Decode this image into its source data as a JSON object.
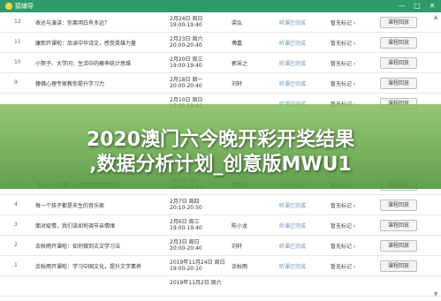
{
  "window": {
    "title": "猿辅导",
    "minimize": "—",
    "restore": "□",
    "close": "✕"
  },
  "rows": [
    {
      "index": "12",
      "title": "表达与演讲：你离明白有多远？",
      "date1": "2月24日 周日",
      "date2": "19:00-19:40",
      "teacher": "梁弘",
      "status": "听课已完成",
      "mark": "暂无标记 ›",
      "button": "课程回放"
    },
    {
      "index": "11",
      "title": "康熙开课啦：品读中华诗文，感受英雄力量",
      "date1": "2月23日 周六",
      "date2": "20:00-20:40",
      "teacher": "傅嘉",
      "status": "听课已完成",
      "mark": "暂无标记 ›",
      "button": "课程回放"
    },
    {
      "index": "10",
      "title": "小贺子、大学问：生活中的概率统计思维",
      "date1": "2月20日 周三",
      "date2": "19:00-19:40",
      "teacher": "郭采之",
      "status": "听课已完成",
      "mark": "暂无标记 ›",
      "button": "课程回放"
    },
    {
      "index": "9",
      "title": "猿佛心理专家教你提升学习力",
      "date1": "2月18日 周一",
      "date2": "20:00-20:40",
      "teacher": "刘轩",
      "status": "听课已完成",
      "mark": "暂无标记 ›",
      "button": "课程回放"
    },
    {
      "index": "",
      "title": "",
      "date1": "2月10日 周日",
      "date2": "19:00-19:40",
      "teacher": "",
      "status": "听课已完成",
      "mark": "暂无标记 ›",
      "button": "课程回放"
    },
    {
      "index": "",
      "title": "",
      "date1": "",
      "date2": "",
      "teacher": "",
      "status": "",
      "mark": "",
      "button": ""
    },
    {
      "index": "",
      "title": "",
      "date1": "",
      "date2": "",
      "teacher": "",
      "status": "",
      "mark": "",
      "button": ""
    },
    {
      "index": "",
      "title": "",
      "date1": "",
      "date2": "",
      "teacher": "",
      "status": "",
      "mark": "",
      "button": ""
    },
    {
      "index": "5",
      "title": "【大师人文课】张海鹰带你品味苏轼",
      "date1": "2月9日 周六",
      "date2": "19:00-19:40",
      "teacher": "纪连海",
      "status": "听课已完成",
      "mark": "暂无标记 ›",
      "button": "课程回放"
    },
    {
      "index": "4",
      "title": "每一个孩子都是天生的音乐家",
      "date1": "2月7日 周四",
      "date2": "20:10-20:50",
      "teacher": "",
      "status": "听课已完成",
      "mark": "暂无标记 ›",
      "button": "课程回放"
    },
    {
      "index": "3",
      "title": "面对疫情，我们该如何调节亲情绪",
      "date1": "2月6日 周三",
      "date2": "19:00-19:40",
      "teacher": "陈小龙",
      "status": "听课已完成",
      "mark": "暂无标记 ›",
      "button": "课程回放"
    },
    {
      "index": "2",
      "title": "余秋雨开课啦：如何做到古文学习法",
      "date1": "2月3日 周日",
      "date2": "20:00-20:40",
      "teacher": "刘轩",
      "status": "听课已完成",
      "mark": "暂无标记 ›",
      "button": "课程回放"
    },
    {
      "index": "1",
      "title": "余秋雨开课啦：学习中国文化，提升文学素养",
      "date1": "2019年11月24日 周日",
      "date2": "19:00-20:10",
      "teacher": "余秋雨",
      "status": "听课已完成",
      "mark": "暂无标记 ›",
      "button": "课程回放"
    },
    {
      "index": "",
      "title": "",
      "date1": "2019年11月2日 周六",
      "date2": "",
      "teacher": "",
      "status": "",
      "mark": "",
      "button": ""
    }
  ],
  "banner": {
    "line1": "2020澳门六今晚开彩开奖结果",
    "line2": ",数据分析计划_创意版MWU1"
  }
}
